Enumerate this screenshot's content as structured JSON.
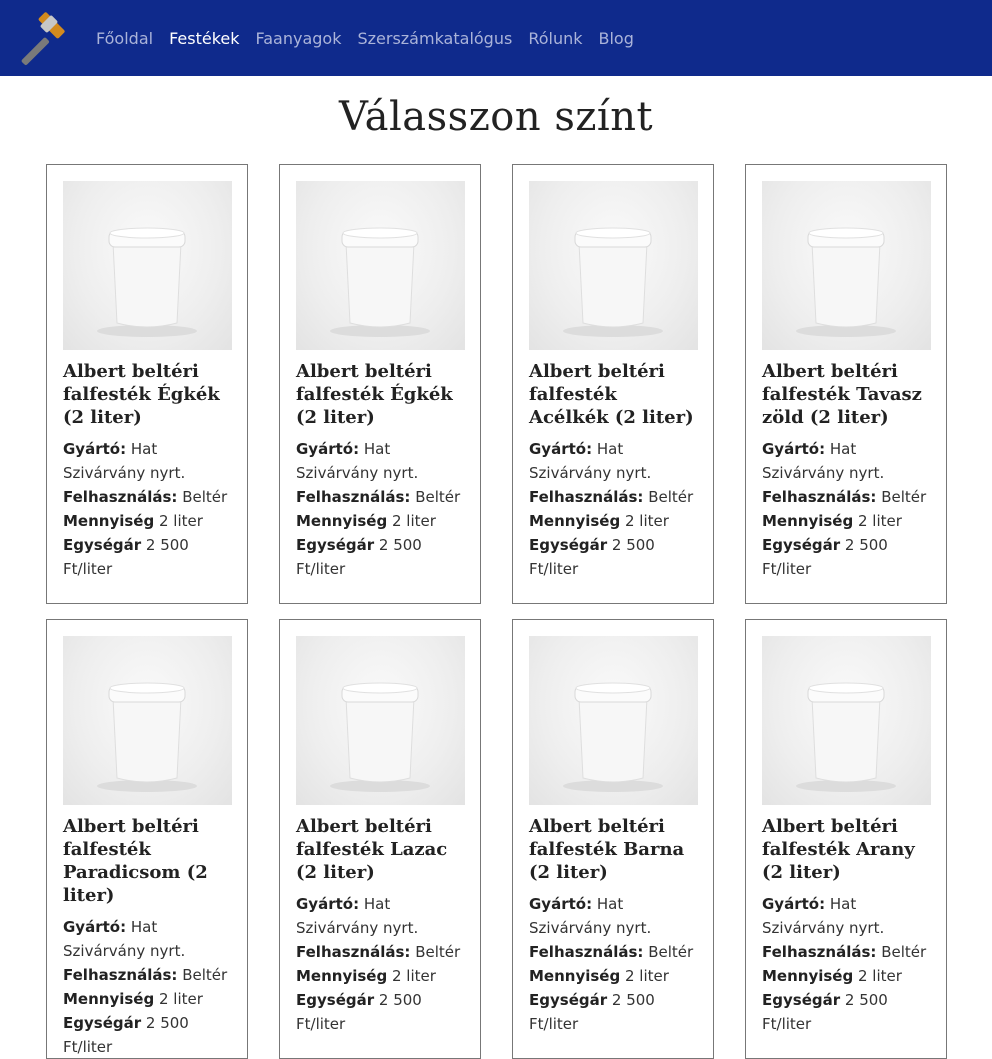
{
  "nav": {
    "items": [
      {
        "label": "Főoldal",
        "active": false
      },
      {
        "label": "Festékek",
        "active": true
      },
      {
        "label": "Faanyagok",
        "active": false
      },
      {
        "label": "Szerszámkatalógus",
        "active": false
      },
      {
        "label": "Rólunk",
        "active": false
      },
      {
        "label": "Blog",
        "active": false
      }
    ],
    "logo_icon": "hammer-icon"
  },
  "page": {
    "title": "Válasszon színt"
  },
  "labels": {
    "manufacturer": "Gyártó:",
    "usage": "Felhasználás:",
    "quantity": "Mennyiség",
    "unit_price": "Egységár"
  },
  "products": [
    {
      "title": "Albert beltéri falfesték Égkék (2 liter)",
      "manufacturer": "Hat Szivárvány nyrt.",
      "usage": "Beltér",
      "quantity": "2 liter",
      "unit_price": "2 500 Ft/liter"
    },
    {
      "title": "Albert beltéri falfesték Égkék (2 liter)",
      "manufacturer": "Hat Szivárvány nyrt.",
      "usage": "Beltér",
      "quantity": "2 liter",
      "unit_price": "2 500 Ft/liter"
    },
    {
      "title": "Albert beltéri falfesték Acélkék (2 liter)",
      "manufacturer": "Hat Szivárvány nyrt.",
      "usage": "Beltér",
      "quantity": "2 liter",
      "unit_price": "2 500 Ft/liter"
    },
    {
      "title": "Albert beltéri falfesték Tavasz zöld (2 liter)",
      "manufacturer": "Hat Szivárvány nyrt.",
      "usage": "Beltér",
      "quantity": "2 liter",
      "unit_price": "2 500 Ft/liter"
    },
    {
      "title": "Albert beltéri falfesték Paradicsom (2 liter)",
      "manufacturer": "Hat Szivárvány nyrt.",
      "usage": "Beltér",
      "quantity": "2 liter",
      "unit_price": "2 500 Ft/liter"
    },
    {
      "title": "Albert beltéri falfesték Lazac (2 liter)",
      "manufacturer": "Hat Szivárvány nyrt.",
      "usage": "Beltér",
      "quantity": "2 liter",
      "unit_price": "2 500 Ft/liter"
    },
    {
      "title": "Albert beltéri falfesték Barna (2 liter)",
      "manufacturer": "Hat Szivárvány nyrt.",
      "usage": "Beltér",
      "quantity": "2 liter",
      "unit_price": "2 500 Ft/liter"
    },
    {
      "title": "Albert beltéri falfesték Arany (2 liter)",
      "manufacturer": "Hat Szivárvány nyrt.",
      "usage": "Beltér",
      "quantity": "2 liter",
      "unit_price": "2 500 Ft/liter"
    }
  ],
  "colors": {
    "navbar": "#0f2a8c",
    "nav_inactive": "#aab3d9",
    "nav_active": "#ffffff"
  }
}
